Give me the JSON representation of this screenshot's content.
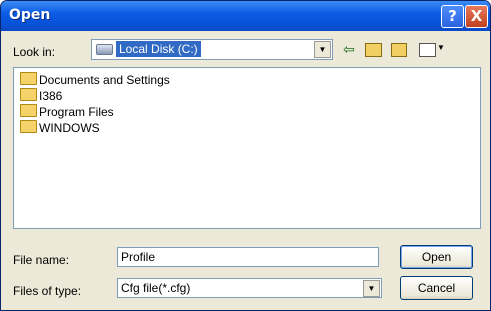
{
  "window": {
    "title": "Open"
  },
  "titlebar_buttons": {
    "help": "?",
    "close": "X"
  },
  "look_in": {
    "label": "Look in:",
    "value": "Local Disk (C:)",
    "icon": "hard-disk-icon"
  },
  "toolbar": {
    "icons": [
      "back-arrow-icon",
      "up-one-level-icon",
      "new-folder-icon",
      "views-menu-icon"
    ]
  },
  "file_list": {
    "items": [
      {
        "name": "Documents and Settings",
        "icon": "folder-icon"
      },
      {
        "name": "I386",
        "icon": "folder-icon"
      },
      {
        "name": "Program Files",
        "icon": "folder-icon"
      },
      {
        "name": "WINDOWS",
        "icon": "folder-icon"
      }
    ]
  },
  "file_name": {
    "label": "File name:",
    "value": "Profile"
  },
  "file_type": {
    "label": "Files of type:",
    "value": "Cfg file(*.cfg)"
  },
  "buttons": {
    "open": "Open",
    "cancel": "Cancel"
  },
  "colors": {
    "titlebar": "#0852d8",
    "selection": "#316ac5",
    "dialog_bg": "#ece9d8"
  }
}
